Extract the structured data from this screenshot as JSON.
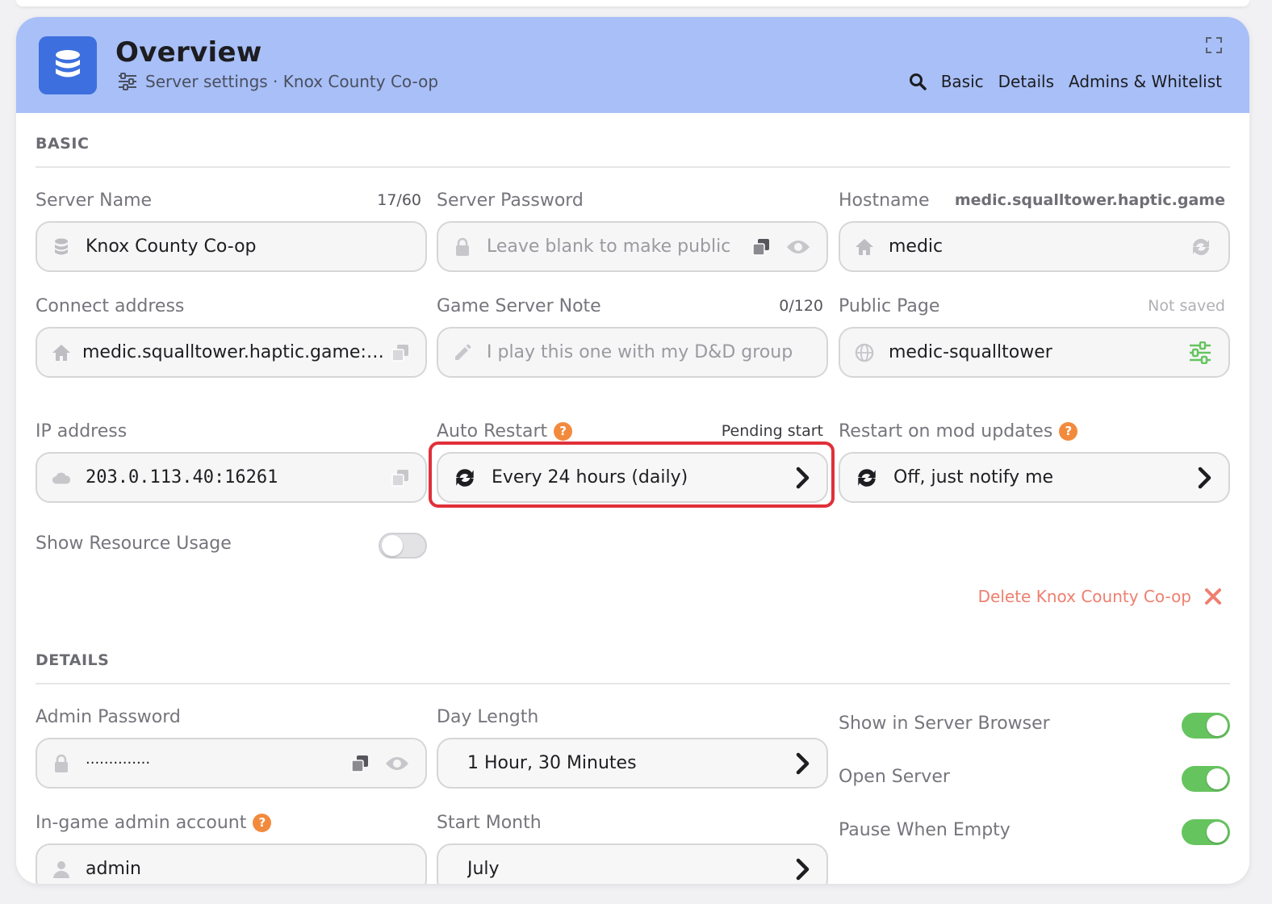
{
  "header": {
    "title": "Overview",
    "subtitle": "Server settings · Knox County Co-op",
    "nav": [
      "Basic",
      "Details",
      "Admins & Whitelist"
    ]
  },
  "basic": {
    "section_title": "BASIC",
    "server_name": {
      "label": "Server Name",
      "counter": "17/60",
      "value": "Knox County Co-op"
    },
    "server_password": {
      "label": "Server Password",
      "placeholder": "Leave blank to make public"
    },
    "hostname": {
      "label": "Hostname",
      "aux": "medic.squalltower.haptic.game",
      "value": "medic"
    },
    "connect_address": {
      "label": "Connect address",
      "value": "medic.squalltower.haptic.game:…"
    },
    "game_server_note": {
      "label": "Game Server Note",
      "counter": "0/120",
      "placeholder": "I play this one with my D&D group"
    },
    "public_page": {
      "label": "Public Page",
      "aux": "Not saved",
      "value": "medic-squalltower"
    },
    "ip_address": {
      "label": "IP address",
      "value": "203.0.113.40:16261"
    },
    "auto_restart": {
      "label": "Auto Restart",
      "aux": "Pending start",
      "value": "Every 24 hours (daily)"
    },
    "restart_mod_updates": {
      "label": "Restart on mod updates",
      "value": "Off, just notify me"
    },
    "show_resource_usage": {
      "label": "Show Resource Usage",
      "enabled": false
    },
    "delete_label": "Delete Knox County Co-op"
  },
  "details": {
    "section_title": "DETAILS",
    "admin_password": {
      "label": "Admin Password",
      "value": "··············"
    },
    "day_length": {
      "label": "Day Length",
      "value": "1 Hour, 30 Minutes"
    },
    "show_in_browser": {
      "label": "Show in Server Browser",
      "enabled": true
    },
    "open_server": {
      "label": "Open Server",
      "enabled": true
    },
    "pause_when_empty": {
      "label": "Pause When Empty",
      "enabled": true
    },
    "ingame_admin": {
      "label": "In-game admin account",
      "value": "admin"
    },
    "start_month": {
      "label": "Start Month",
      "value": "July"
    }
  },
  "colors": {
    "header_bg": "#a8bff8",
    "accent_blue": "#3d6fde",
    "toggle_on": "#66c45f",
    "highlight": "#e0303a",
    "help_orange": "#f28a3d",
    "danger": "#ef7f6f"
  }
}
